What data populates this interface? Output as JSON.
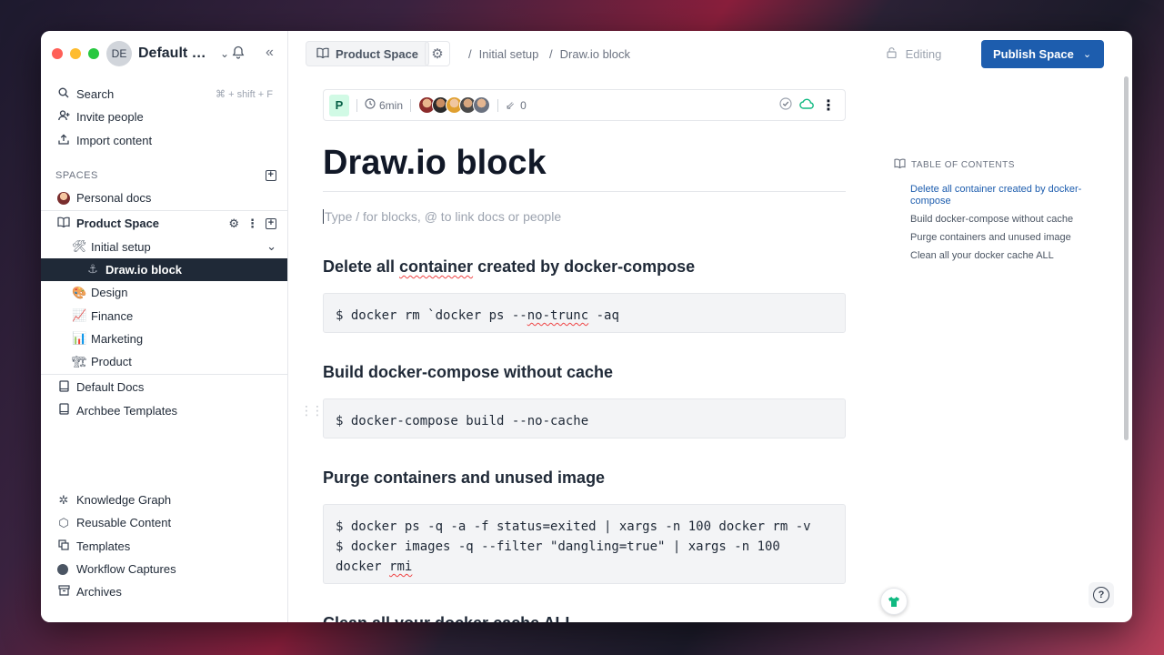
{
  "sidebar": {
    "workspace": {
      "initials": "DE",
      "name": "Default D..."
    },
    "actions": [
      {
        "label": "Search",
        "shortcut": "⌘ + shift + F"
      },
      {
        "label": "Invite people"
      },
      {
        "label": "Import content"
      }
    ],
    "spaces_heading": "SPACES",
    "personal_docs": "Personal docs",
    "product_space": "Product Space",
    "tree": {
      "initial_setup": "Initial setup",
      "drawio_block": "Draw.io block",
      "design": "Design",
      "finance": "Finance",
      "marketing": "Marketing",
      "product": "Product"
    },
    "other_spaces": [
      "Default Docs",
      "Archbee Templates"
    ],
    "bottom": [
      "Knowledge Graph",
      "Reusable Content",
      "Templates",
      "Workflow Captures",
      "Archives"
    ]
  },
  "topbar": {
    "space_name": "Product Space",
    "breadcrumbs": [
      "Initial setup",
      "Draw.io block"
    ],
    "status": "Editing",
    "publish_label": "Publish Space"
  },
  "doc_meta": {
    "badge": "P",
    "read_time": "6min",
    "link_count": "0"
  },
  "doc": {
    "title": "Draw.io block",
    "placeholder": "Type / for blocks, @ to link docs or people",
    "sections": [
      {
        "heading_pre": "Delete all ",
        "heading_squig": "container",
        "heading_post": " created by docker-compose",
        "code_pre": "$ docker rm `docker ps --",
        "code_squig": "no-trunc",
        "code_post": " -aq"
      },
      {
        "heading": "Build docker-compose without cache",
        "code": "$ docker-compose build --no-cache"
      },
      {
        "heading": "Purge containers and unused image",
        "code_line1": "$ docker ps -q -a -f status=exited | xargs -n 100 docker rm -v",
        "code_line2": "$ docker images -q --filter \"dangling=true\" | xargs -n 100",
        "code_line3_pre": "docker ",
        "code_line3_squig": "rmi"
      },
      {
        "heading": "Clean all your docker cache ALL"
      }
    ]
  },
  "toc": {
    "heading": "TABLE OF CONTENTS",
    "items": [
      "Delete all container created by docker-compose",
      "Build docker-compose without cache",
      "Purge containers and unused image",
      "Clean all your docker cache ALL"
    ]
  },
  "colors": {
    "accent": "#1d5dae",
    "active_row": "#1f2937"
  },
  "help_label": "?"
}
